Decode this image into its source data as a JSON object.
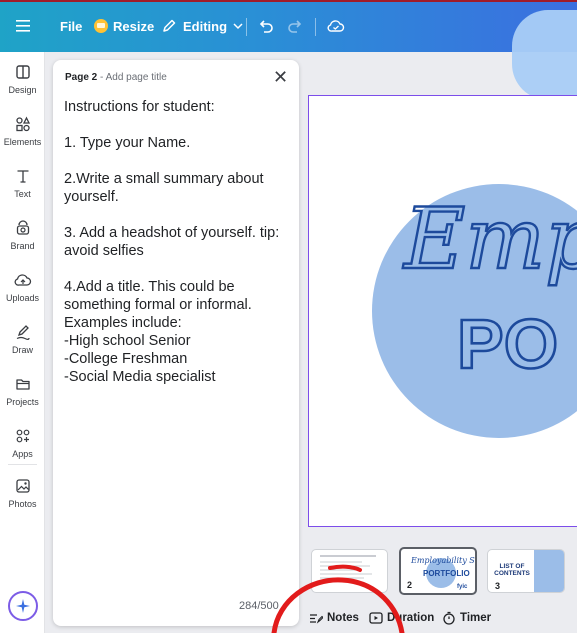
{
  "topbar": {
    "file_label": "File",
    "resize_label": "Resize",
    "editing_label": "Editing"
  },
  "sidebar": {
    "items": [
      {
        "label": "Design"
      },
      {
        "label": "Elements"
      },
      {
        "label": "Text"
      },
      {
        "label": "Brand"
      },
      {
        "label": "Uploads"
      },
      {
        "label": "Draw"
      },
      {
        "label": "Projects"
      },
      {
        "label": "Apps"
      },
      {
        "label": "Photos"
      }
    ]
  },
  "notes_panel": {
    "page_label": "Page 2",
    "page_separator": " - ",
    "title_placeholder": "Add page title",
    "lines": [
      "Instructions for student:",
      "",
      "1. Type your Name.",
      "",
      "2.Write a small summary about yourself.",
      "",
      "3. Add a headshot of yourself. tip: avoid selfies",
      "",
      "4.Add a title. This could be something formal or informal. Examples include:",
      "-High school Senior",
      "-College Freshman",
      "-Social Media specialist"
    ],
    "char_count": "284/500"
  },
  "canvas": {
    "script_text": "Employ",
    "outline_text": "PO"
  },
  "filmstrip": {
    "pages": [
      {
        "number": "1"
      },
      {
        "number": "2",
        "script": "Employability Skills",
        "subtitle": "PORTFOLIO",
        "brand": "fyic"
      },
      {
        "number": "3",
        "title_line1": "LIST OF",
        "title_line2": "CONTENTS"
      }
    ]
  },
  "bottom_bar": {
    "notes_label": "Notes",
    "duration_label": "Duration",
    "timer_label": "Timer"
  },
  "colors": {
    "topbar_start": "#1fa3c7",
    "topbar_end": "#3b6fe0",
    "selection": "#7c4dea",
    "design_blue": "#1d4a9c",
    "circle_blue": "#9bbde8",
    "annotation_red": "#e21b1b"
  }
}
